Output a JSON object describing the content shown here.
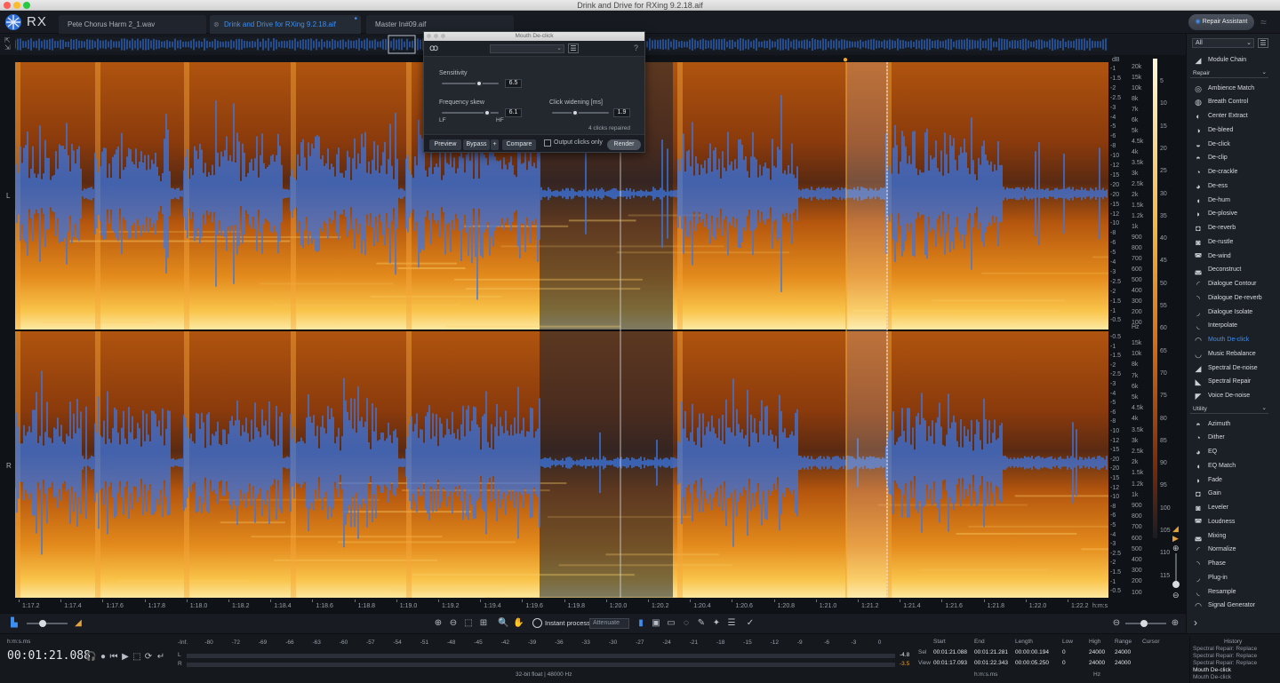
{
  "window": {
    "title": "Drink and Drive for RXing 9.2.18.aif"
  },
  "app": {
    "logo_text": "RX",
    "repair_assistant_label": "Repair Assistant"
  },
  "tabs": [
    {
      "label": "Pete Chorus Harm 2_1.wav"
    },
    {
      "label": "Drink and Drive for RXing 9.2.18.aif"
    },
    {
      "label": "Master In#09.aif"
    }
  ],
  "dialog": {
    "title": "Mouth De-click",
    "help": "?",
    "sensitivity_label": "Sensitivity",
    "sensitivity_value": "6.5",
    "sensitivity_level": 0.65,
    "frequency_skew_label": "Frequency skew",
    "frequency_skew_value": "6.1",
    "frequency_skew_level": 0.8,
    "lf_label": "LF",
    "hf_label": "HF",
    "click_widening_label": "Click widening [ms]",
    "click_widening_value": "1.9",
    "click_widening_level": 0.4,
    "clicks_repaired": "4 clicks repaired",
    "preview_label": "Preview",
    "bypass_label": "Bypass",
    "plus_label": "+",
    "compare_label": "Compare",
    "output_clicks_label": "Output clicks only",
    "render_label": "Render"
  },
  "channels": {
    "left": "L",
    "right": "R"
  },
  "db_scale": {
    "unit": "dB",
    "left": [
      "-1",
      "-1.5",
      "-2",
      "-2.5",
      "-3",
      "-4",
      "-5",
      "-6",
      "-8",
      "-10",
      "-12",
      "-15",
      "-20",
      "-20",
      "-15",
      "-12",
      "-10",
      "-8",
      "-6",
      "-5",
      "-4",
      "-3",
      "-2.5",
      "-2",
      "-1.5",
      "-1",
      "-0.5"
    ],
    "right": [
      "-0.5",
      "-1",
      "-1.5",
      "-2",
      "-2.5",
      "-3",
      "-4",
      "-5",
      "-6",
      "-8",
      "-10",
      "-12",
      "-15",
      "-20",
      "-20",
      "-15",
      "-12",
      "-10",
      "-8",
      "-6",
      "-5",
      "-4",
      "-3",
      "-2.5",
      "-2",
      "-1.5",
      "-1",
      "-0.5"
    ]
  },
  "freq_scale": {
    "unit": "Hz",
    "left": [
      "20k",
      "15k",
      "10k",
      "8k",
      "7k",
      "6k",
      "5k",
      "4.5k",
      "4k",
      "3.5k",
      "3k",
      "2.5k",
      "2k",
      "1.5k",
      "1.2k",
      "1k",
      "900",
      "800",
      "700",
      "600",
      "500",
      "400",
      "300",
      "200",
      "100"
    ],
    "right": [
      "15k",
      "10k",
      "8k",
      "7k",
      "6k",
      "5k",
      "4.5k",
      "4k",
      "3.5k",
      "3k",
      "2.5k",
      "2k",
      "1.5k",
      "1.2k",
      "1k",
      "900",
      "800",
      "700",
      "600",
      "500",
      "400",
      "300",
      "200",
      "100"
    ]
  },
  "color_scale": {
    "unit": "dB",
    "ticks": [
      "5",
      "10",
      "15",
      "20",
      "25",
      "30",
      "35",
      "40",
      "45",
      "50",
      "55",
      "60",
      "65",
      "70",
      "75",
      "80",
      "85",
      "90",
      "95",
      "100",
      "105",
      "110",
      "115"
    ]
  },
  "timeline": {
    "ticks": [
      "1:17.2",
      "1:17.4",
      "1:17.6",
      "1:17.8",
      "1:18.0",
      "1:18.2",
      "1:18.4",
      "1:18.6",
      "1:18.8",
      "1:19.0",
      "1:19.2",
      "1:19.4",
      "1:19.6",
      "1:19.8",
      "1:20.0",
      "1:20.2",
      "1:20.4",
      "1:20.6",
      "1:20.8",
      "1:21.0",
      "1:21.2",
      "1:21.4",
      "1:21.6",
      "1:21.8",
      "1:22.0",
      "1:22.2"
    ],
    "unit": "h:m:s"
  },
  "toolbar": {
    "instant_process_label": "Instant process",
    "mode_value": "Attenuate"
  },
  "transport": {
    "format_label": "h:m:s.ms",
    "time": "00:01:21.088"
  },
  "meter": {
    "ticks": [
      "-Inf.",
      "-80",
      "-72",
      "-69",
      "-66",
      "-63",
      "-60",
      "-57",
      "-54",
      "-51",
      "-48",
      "-45",
      "-42",
      "-39",
      "-36",
      "-33",
      "-30",
      "-27",
      "-24",
      "-21",
      "-18",
      "-15",
      "-12",
      "-9",
      "-6",
      "-3",
      "0"
    ],
    "l_label": "L",
    "r_label": "R",
    "l_peak": "-4.8",
    "r_peak": "-3.5",
    "format": "32-bit float | 48000 Hz"
  },
  "selection": {
    "headers": [
      "Start",
      "End",
      "Length",
      "Low",
      "High",
      "Range",
      "Cursor"
    ],
    "sel_label": "Sel",
    "view_label": "View",
    "sel": {
      "start": "00:01:21.088",
      "end": "00:01:21.281",
      "length": "00:00:00.194",
      "low": "0",
      "high": "24000",
      "range": "24000"
    },
    "view": {
      "start": "00:01:17.093",
      "end": "00:01:22.343",
      "length": "00:00:05.250",
      "low": "0",
      "high": "24000",
      "range": "24000"
    },
    "time_unit": "h:m:s.ms",
    "freq_unit": "Hz"
  },
  "history": {
    "title": "History",
    "items": [
      "Spectral Repair: Replace",
      "Spectral Repair: Replace",
      "Spectral Repair: Replace",
      "Mouth De-click",
      "Mouth De-click"
    ]
  },
  "module_panel": {
    "filter_value": "All",
    "module_chain_label": "Module Chain",
    "repair_label": "Repair",
    "utility_label": "Utility",
    "repair": [
      "Ambience Match",
      "Breath Control",
      "Center Extract",
      "De-bleed",
      "De-click",
      "De-clip",
      "De-crackle",
      "De-ess",
      "De-hum",
      "De-plosive",
      "De-reverb",
      "De-rustle",
      "De-wind",
      "Deconstruct",
      "Dialogue Contour",
      "Dialogue De-reverb",
      "Dialogue Isolate",
      "Interpolate",
      "Mouth De-click",
      "Music Rebalance",
      "Spectral De-noise",
      "Spectral Repair",
      "Voice De-noise"
    ],
    "utility": [
      "Azimuth",
      "Dither",
      "EQ",
      "EQ Match",
      "Fade",
      "Gain",
      "Leveler",
      "Loudness",
      "Mixing",
      "Normalize",
      "Phase",
      "Plug-in",
      "Resample",
      "Signal Generator"
    ],
    "active": "Mouth De-click"
  },
  "colors": {
    "accent": "#3d8ef0",
    "waveform": "#3a78e8"
  }
}
